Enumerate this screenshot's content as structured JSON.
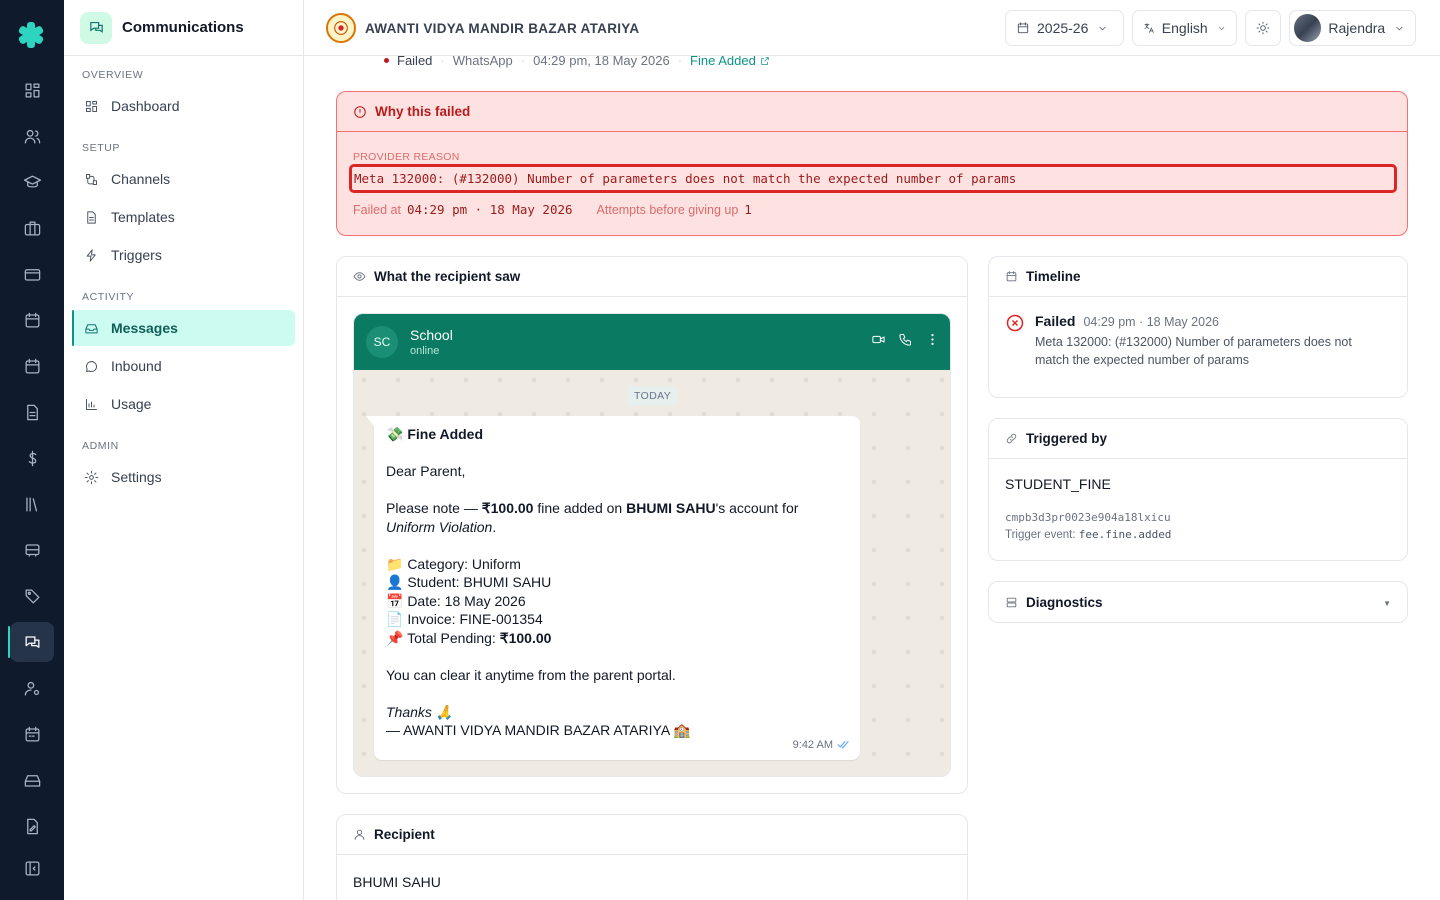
{
  "sidebar": {
    "title": "Communications",
    "sections": [
      {
        "label": "OVERVIEW"
      },
      {
        "label": "SETUP"
      },
      {
        "label": "ACTIVITY"
      },
      {
        "label": "ADMIN"
      }
    ],
    "items": [
      {
        "label": "Dashboard",
        "icon": "dashboard-icon"
      },
      {
        "label": "Channels",
        "icon": "channels-icon"
      },
      {
        "label": "Templates",
        "icon": "file-icon"
      },
      {
        "label": "Triggers",
        "icon": "zap-icon"
      },
      {
        "label": "Messages",
        "icon": "inbox-icon",
        "active": true
      },
      {
        "label": "Inbound",
        "icon": "message-circle-icon"
      },
      {
        "label": "Usage",
        "icon": "bar-chart-icon"
      },
      {
        "label": "Settings",
        "icon": "gear-icon"
      }
    ]
  },
  "topbar": {
    "school_name": "AWANTI VIDYA MANDIR BAZAR ATARIYA",
    "year": "2025-26",
    "language": "English",
    "user": "Rajendra"
  },
  "message_meta": {
    "status": "Failed",
    "channel": "WhatsApp",
    "timestamp": "04:29 pm, 18 May 2026",
    "template_link": "Fine Added"
  },
  "failure": {
    "title": "Why this failed",
    "provider_reason_label": "PROVIDER REASON",
    "provider_reason": "Meta 132000: (#132000) Number of parameters does not match the expected number of params",
    "failed_at_label": "Failed at",
    "failed_at": "04:29 pm · 18 May 2026",
    "attempts_label": "Attempts before giving up",
    "attempts": "1"
  },
  "preview": {
    "title": "What the recipient saw",
    "contact_initials": "SC",
    "contact_name": "School",
    "contact_status": "online",
    "day_label": "TODAY",
    "time": "9:42 AM",
    "lines": {
      "l1": "💸 Fine Added",
      "l2": "Dear Parent,",
      "l3a": "Please note — ",
      "l3b": "₹100.00",
      "l3c": " fine added on ",
      "l3d": "BHUMI SAHU",
      "l3e": "'s account for",
      "l4": "Uniform Violation",
      "l4b": ".",
      "l5": "📁 Category: Uniform",
      "l6": "👤 Student: BHUMI SAHU",
      "l7": "📅 Date: 18 May 2026",
      "l8": "📄 Invoice: FINE-001354",
      "l9a": "📌 Total Pending: ",
      "l9b": "₹100.00",
      "l10": "You can clear it anytime from the parent portal.",
      "l11": "Thanks 🙏",
      "l12": "— AWANTI VIDYA MANDIR BAZAR ATARIYA 🏫"
    }
  },
  "timeline": {
    "title": "Timeline",
    "events": [
      {
        "status": "Failed",
        "time": "04:29 pm · 18 May 2026",
        "message": "Meta 132000: (#132000) Number of parameters does not match the expected number of params"
      }
    ]
  },
  "triggered_by": {
    "title": "Triggered by",
    "name": "STUDENT_FINE",
    "id": "cmpb3d3pr0023e904a18lxicu",
    "event_label": "Trigger event: ",
    "event": "fee.fine.added"
  },
  "diagnostics": {
    "title": "Diagnostics"
  },
  "recipient": {
    "title": "Recipient",
    "name": "BHUMI SAHU"
  }
}
